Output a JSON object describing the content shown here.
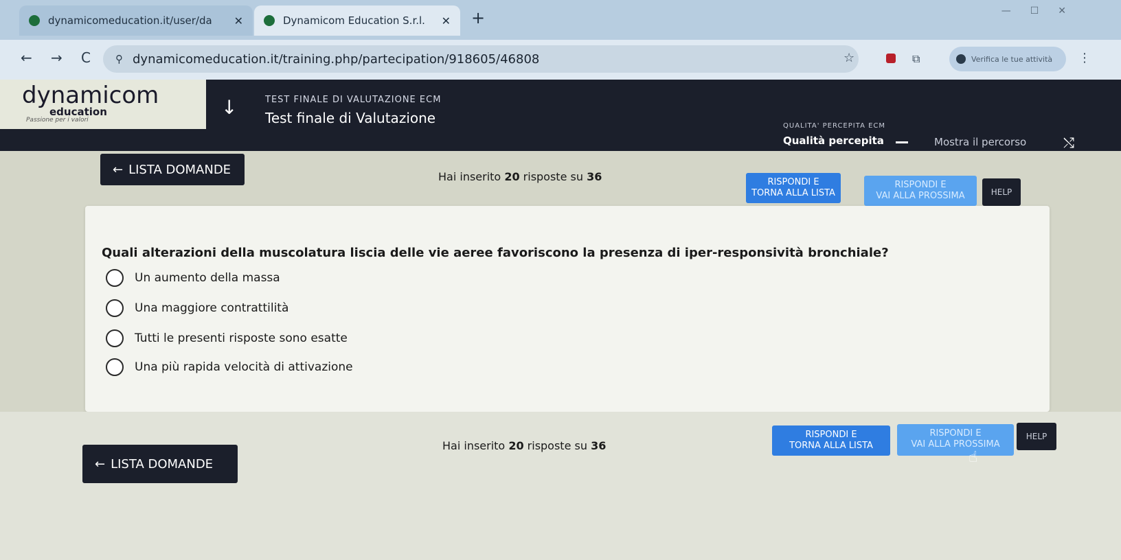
{
  "browser": {
    "tabs": [
      {
        "title": "dynamicomeducation.it/user/da",
        "active": false
      },
      {
        "title": "Dynamicom Education S.r.l.",
        "active": true
      }
    ],
    "url": "dynamicomeducation.it/training.php/partecipation/918605/46808",
    "verify_label": "Verifica le tue attività"
  },
  "header": {
    "logo_main": "dynamicom",
    "logo_sub": "education",
    "logo_tagline": "Passione per i valori",
    "test_small": "TEST FINALE DI VALUTAZIONE ECM",
    "test_title": "Test finale di Valutazione",
    "qp_small": "QUALITA' PERCEPITA ECM",
    "qp_title": "Qualità percepita",
    "show_path": "Mostra il percorso"
  },
  "actions": {
    "list_label": "LISTA DOMANDE",
    "count_prefix": "Hai inserito ",
    "count_done": "20",
    "count_middle": " risposte su ",
    "count_total": "36",
    "answer_return_l1": "RISPONDI E",
    "answer_return_l2": "TORNA ALLA LISTA",
    "answer_next_l1": "RISPONDI E",
    "answer_next_l2": "VAI ALLA PROSSIMA",
    "help_label": "HELP"
  },
  "question": {
    "text": "Quali alterazioni della muscolatura liscia delle vie aeree favoriscono la presenza di iper-responsività bronchiale?",
    "options": [
      "Un aumento della massa",
      "Una maggiore contrattilità",
      "Tutti le presenti risposte sono esatte",
      "Una più rapida velocità di attivazione"
    ]
  },
  "icons": {
    "back": "←",
    "forward": "→",
    "reload": "C",
    "site_info": "⚲",
    "star": "☆",
    "down_arrow": "↓",
    "shuffle": "⤭",
    "close": "✕",
    "plus": "+",
    "kebab": "⋮",
    "cursor": "☝"
  },
  "colors": {
    "header_bg": "#1b1f2b",
    "primary_button": "#2f7de1",
    "page_bg": "#d4d6c8"
  }
}
